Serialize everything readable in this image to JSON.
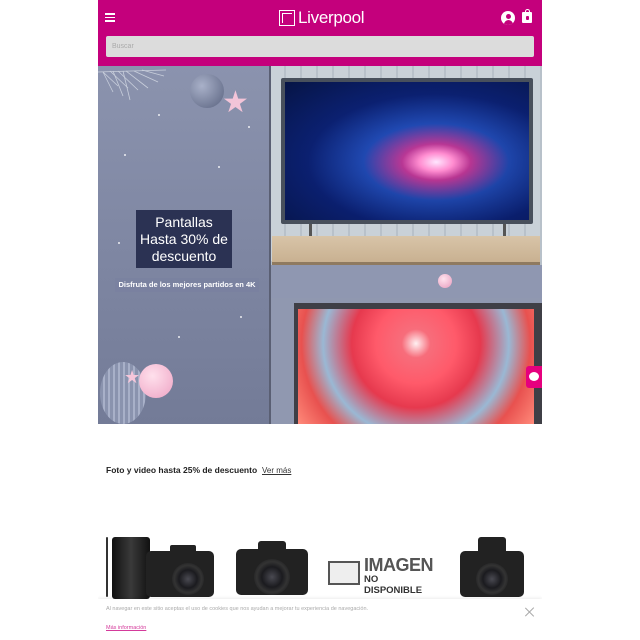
{
  "header": {
    "logo_text": "Liverpool",
    "brand_color": "#c4007c",
    "search_placeholder": "Buscar"
  },
  "banner": {
    "headline": [
      "Pantallas",
      "Hasta 30% de",
      "descuento"
    ],
    "subtitle": "Disfruta de los mejores partidos en 4K"
  },
  "section": {
    "title": "Foto y video hasta 25% de descuento",
    "see_more": "Ver más"
  },
  "products": {
    "no_image_text": [
      "IMAGEN",
      "NO DISPONIBLE"
    ]
  },
  "cookie": {
    "text": "Al navegar en este sitio aceptas el uso de cookies que nos ayudan a mejorar tu experiencia de navegación.",
    "link": "Más información"
  },
  "icons": [
    "menu-icon",
    "logo-icon",
    "user-icon",
    "shopping-bag-icon",
    "chat-icon",
    "close-icon",
    "no-image-icon"
  ]
}
